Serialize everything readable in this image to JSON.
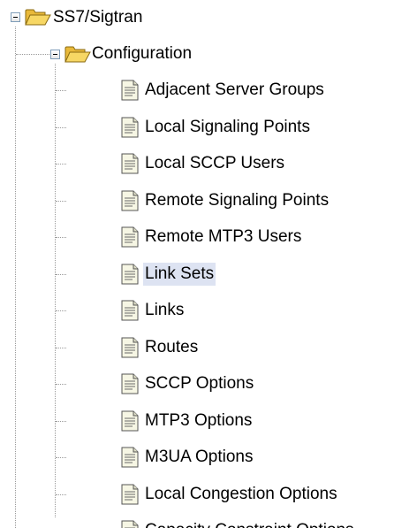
{
  "tree": {
    "root": {
      "label": "SS7/Sigtran",
      "icon": "folder-open-icon",
      "expanded": true
    },
    "configuration": {
      "label": "Configuration",
      "icon": "folder-open-icon",
      "expanded": true
    },
    "items": [
      {
        "label": "Adjacent Server Groups",
        "icon": "document-icon"
      },
      {
        "label": "Local Signaling Points",
        "icon": "document-icon"
      },
      {
        "label": "Local SCCP Users",
        "icon": "document-icon"
      },
      {
        "label": "Remote Signaling Points",
        "icon": "document-icon"
      },
      {
        "label": "Remote MTP3 Users",
        "icon": "document-icon"
      },
      {
        "label": "Link Sets",
        "icon": "document-icon",
        "selected": true
      },
      {
        "label": "Links",
        "icon": "document-icon"
      },
      {
        "label": "Routes",
        "icon": "document-icon"
      },
      {
        "label": "SCCP Options",
        "icon": "document-icon"
      },
      {
        "label": "MTP3 Options",
        "icon": "document-icon"
      },
      {
        "label": "M3UA Options",
        "icon": "document-icon"
      },
      {
        "label": "Local Congestion Options",
        "icon": "document-icon"
      },
      {
        "label": "Capacity Constraint Options",
        "icon": "document-icon"
      }
    ],
    "colors": {
      "selection": "#dde3f2",
      "folder": "#f5c94c",
      "guide_line": "#9a9a9a"
    }
  }
}
